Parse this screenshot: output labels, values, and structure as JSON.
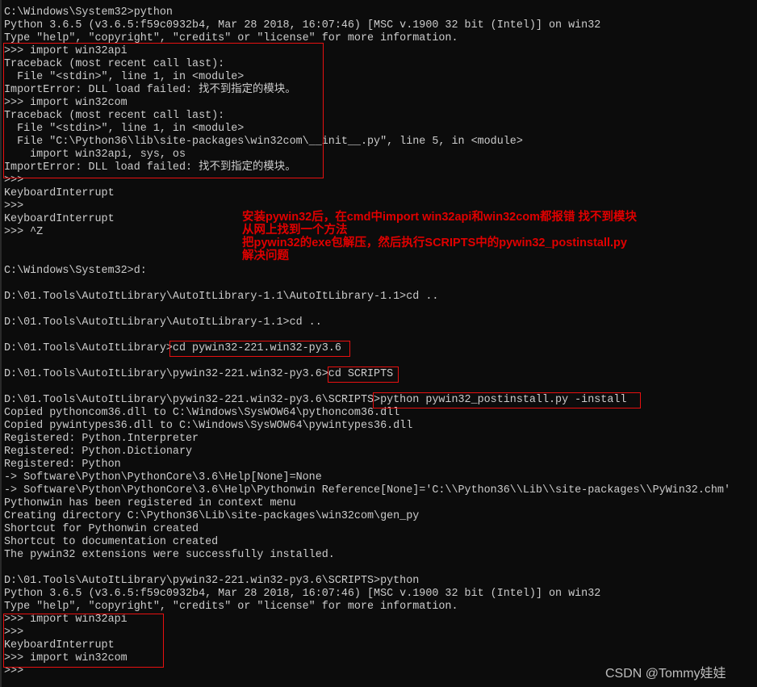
{
  "terminal": {
    "lines": [
      "C:\\Windows\\System32>python",
      "Python 3.6.5 (v3.6.5:f59c0932b4, Mar 28 2018, 16:07:46) [MSC v.1900 32 bit (Intel)] on win32",
      "Type \"help\", \"copyright\", \"credits\" or \"license\" for more information.",
      ">>> import win32api",
      "Traceback (most recent call last):",
      "  File \"<stdin>\", line 1, in <module>",
      "ImportError: DLL load failed: 找不到指定的模块。",
      ">>> import win32com",
      "Traceback (most recent call last):",
      "  File \"<stdin>\", line 1, in <module>",
      "  File \"C:\\Python36\\lib\\site-packages\\win32com\\__init__.py\", line 5, in <module>",
      "    import win32api, sys, os",
      "ImportError: DLL load failed: 找不到指定的模块。",
      ">>>",
      "KeyboardInterrupt",
      ">>>",
      "KeyboardInterrupt",
      ">>> ^Z",
      "",
      "",
      "C:\\Windows\\System32>d:",
      "",
      "D:\\01.Tools\\AutoItLibrary\\AutoItLibrary-1.1\\AutoItLibrary-1.1>cd ..",
      "",
      "D:\\01.Tools\\AutoItLibrary\\AutoItLibrary-1.1>cd ..",
      "",
      "D:\\01.Tools\\AutoItLibrary>cd pywin32-221.win32-py3.6",
      "",
      "D:\\01.Tools\\AutoItLibrary\\pywin32-221.win32-py3.6>cd SCRIPTS",
      "",
      "D:\\01.Tools\\AutoItLibrary\\pywin32-221.win32-py3.6\\SCRIPTS>python pywin32_postinstall.py -install",
      "Copied pythoncom36.dll to C:\\Windows\\SysWOW64\\pythoncom36.dll",
      "Copied pywintypes36.dll to C:\\Windows\\SysWOW64\\pywintypes36.dll",
      "Registered: Python.Interpreter",
      "Registered: Python.Dictionary",
      "Registered: Python",
      "-> Software\\Python\\PythonCore\\3.6\\Help[None]=None",
      "-> Software\\Python\\PythonCore\\3.6\\Help\\Pythonwin Reference[None]='C:\\\\Python36\\\\Lib\\\\site-packages\\\\PyWin32.chm'",
      "Pythonwin has been registered in context menu",
      "Creating directory C:\\Python36\\Lib\\site-packages\\win32com\\gen_py",
      "Shortcut for Pythonwin created",
      "Shortcut to documentation created",
      "The pywin32 extensions were successfully installed.",
      "",
      "D:\\01.Tools\\AutoItLibrary\\pywin32-221.win32-py3.6\\SCRIPTS>python",
      "Python 3.6.5 (v3.6.5:f59c0932b4, Mar 28 2018, 16:07:46) [MSC v.1900 32 bit (Intel)] on win32",
      "Type \"help\", \"copyright\", \"credits\" or \"license\" for more information.",
      ">>> import win32api",
      ">>>",
      "KeyboardInterrupt",
      ">>> import win32com",
      ">>>"
    ]
  },
  "annotation": {
    "lines": [
      "安装pywin32后，在cmd中import win32api和win32com都报错 找不到模块",
      "从网上找到一个方法",
      "把pywin32的exe包解压，然后执行SCRIPTS中的pywin32_postinstall.py",
      "解决问题"
    ]
  },
  "watermark": "CSDN @Tommy娃娃",
  "colors": {
    "background": "#0c0c0c",
    "text": "#cccccc",
    "highlight": "#e81010"
  }
}
